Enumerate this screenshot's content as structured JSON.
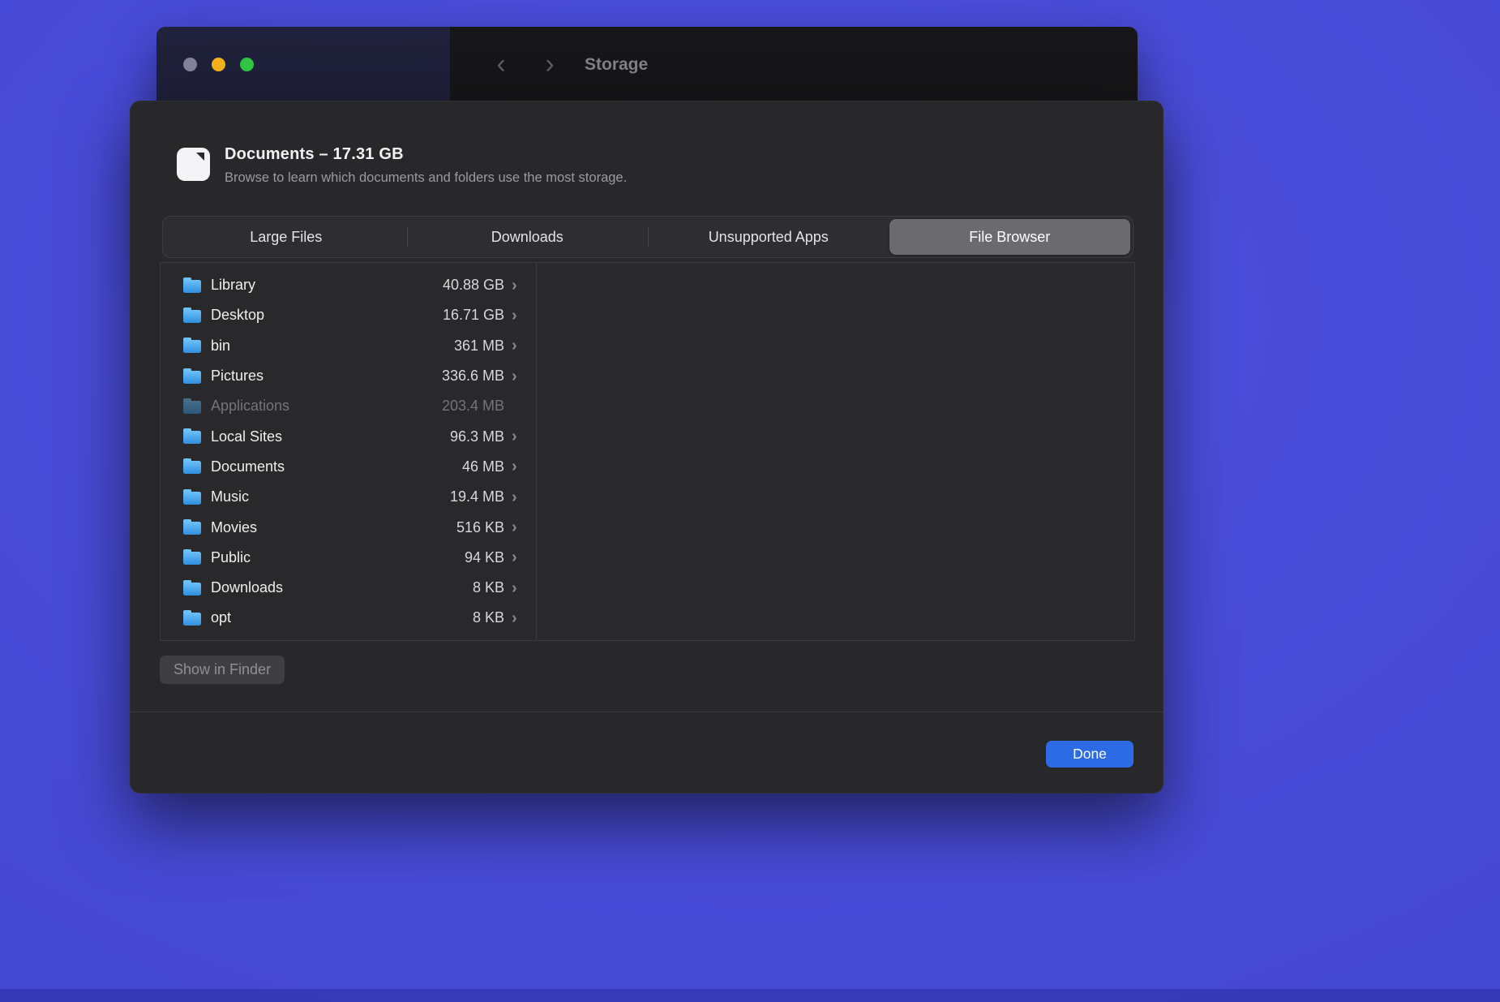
{
  "colors": {
    "accent_blue": "#2d6be5",
    "folder_blue": "#2f8fe0",
    "folder_blue_light": "#6cc1f7",
    "traffic_close": "#83839c",
    "traffic_min": "#f6b21b",
    "traffic_zoom": "#30c643"
  },
  "icons": {
    "back": "‹",
    "forward": "›",
    "chevron_right": "›"
  },
  "window": {
    "title": "Storage"
  },
  "sheet": {
    "header": {
      "title": "Documents – 17.31 GB",
      "subtitle": "Browse to learn which documents and folders use the most storage."
    },
    "tabs": [
      {
        "label": "Large Files",
        "selected": false
      },
      {
        "label": "Downloads",
        "selected": false
      },
      {
        "label": "Unsupported Apps",
        "selected": false
      },
      {
        "label": "File Browser",
        "selected": true
      }
    ],
    "files": [
      {
        "name": "Library",
        "size": "40.88 GB",
        "disabled": false
      },
      {
        "name": "Desktop",
        "size": "16.71 GB",
        "disabled": false
      },
      {
        "name": "bin",
        "size": "361 MB",
        "disabled": false
      },
      {
        "name": "Pictures",
        "size": "336.6 MB",
        "disabled": false
      },
      {
        "name": "Applications",
        "size": "203.4 MB",
        "disabled": true
      },
      {
        "name": "Local Sites",
        "size": "96.3 MB",
        "disabled": false
      },
      {
        "name": "Documents",
        "size": "46 MB",
        "disabled": false
      },
      {
        "name": "Music",
        "size": "19.4 MB",
        "disabled": false
      },
      {
        "name": "Movies",
        "size": "516 KB",
        "disabled": false
      },
      {
        "name": "Public",
        "size": "94 KB",
        "disabled": false
      },
      {
        "name": "Downloads",
        "size": "8 KB",
        "disabled": false
      },
      {
        "name": "opt",
        "size": "8 KB",
        "disabled": false
      }
    ],
    "show_in_finder_label": "Show in Finder",
    "done_label": "Done"
  }
}
